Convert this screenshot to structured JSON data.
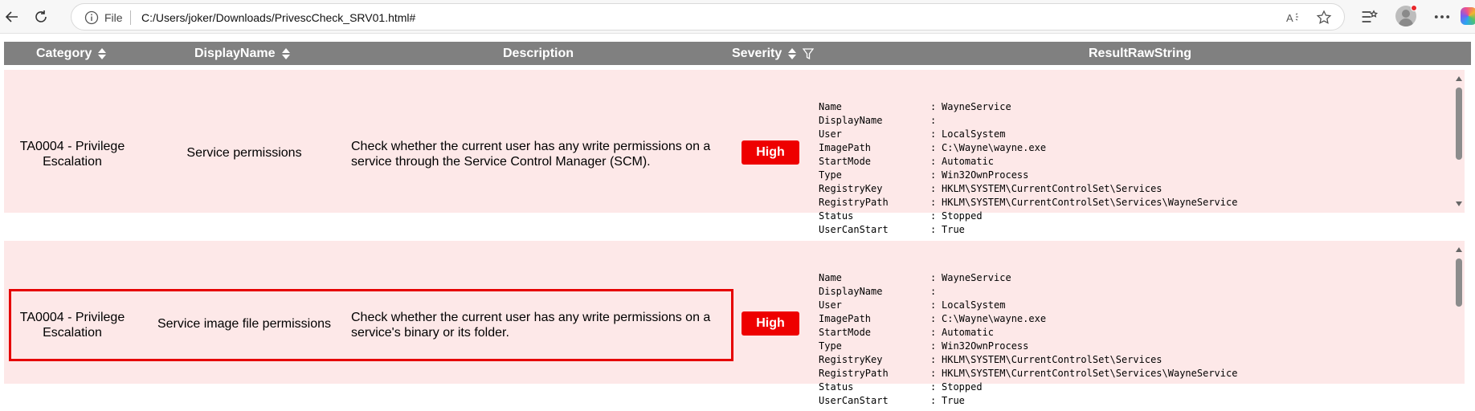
{
  "browser": {
    "file_label": "File",
    "url": "C:/Users/joker/Downloads/PrivescCheck_SRV01.html#",
    "icons": [
      "back-icon",
      "reload-icon",
      "info-icon",
      "read-aloud-icon",
      "favorite-icon",
      "collections-icon",
      "profile-avatar",
      "more-icon",
      "copilot-icon"
    ]
  },
  "table": {
    "headers": {
      "category": "Category",
      "displayname": "DisplayName",
      "description": "Description",
      "severity": "Severity",
      "resultrawstring": "ResultRawString"
    },
    "rows": [
      {
        "category_line1": "TA0004 - Privilege",
        "category_line2": "Escalation",
        "displayname": "Service permissions",
        "description_line1": "Check whether the current user has any write permissions on a",
        "description_line2": "service through the Service Control Manager (SCM).",
        "severity": "High",
        "raw": [
          {
            "key": "Name",
            "value": "WayneService"
          },
          {
            "key": "DisplayName",
            "value": ""
          },
          {
            "key": "User",
            "value": "LocalSystem"
          },
          {
            "key": "ImagePath",
            "value": "C:\\Wayne\\wayne.exe"
          },
          {
            "key": "StartMode",
            "value": "Automatic"
          },
          {
            "key": "Type",
            "value": "Win32OwnProcess"
          },
          {
            "key": "RegistryKey",
            "value": "HKLM\\SYSTEM\\CurrentControlSet\\Services"
          },
          {
            "key": "RegistryPath",
            "value": "HKLM\\SYSTEM\\CurrentControlSet\\Services\\WayneService"
          },
          {
            "key": "Status",
            "value": "Stopped"
          },
          {
            "key": "UserCanStart",
            "value": "True"
          }
        ]
      },
      {
        "category_line1": "TA0004 - Privilege",
        "category_line2": "Escalation",
        "displayname": "Service image file permissions",
        "description_line1": "Check whether the current user has any write permissions on a",
        "description_line2": "service's binary or its folder.",
        "severity": "High",
        "raw": [
          {
            "key": "Name",
            "value": "WayneService"
          },
          {
            "key": "DisplayName",
            "value": ""
          },
          {
            "key": "User",
            "value": "LocalSystem"
          },
          {
            "key": "ImagePath",
            "value": "C:\\Wayne\\wayne.exe"
          },
          {
            "key": "StartMode",
            "value": "Automatic"
          },
          {
            "key": "Type",
            "value": "Win32OwnProcess"
          },
          {
            "key": "RegistryKey",
            "value": "HKLM\\SYSTEM\\CurrentControlSet\\Services"
          },
          {
            "key": "RegistryPath",
            "value": "HKLM\\SYSTEM\\CurrentControlSet\\Services\\WayneService"
          },
          {
            "key": "Status",
            "value": "Stopped"
          },
          {
            "key": "UserCanStart",
            "value": "True"
          }
        ]
      }
    ],
    "raw_separator": ":"
  },
  "colors": {
    "header_bg": "#808080",
    "row_bg": "#fde8e8",
    "severity_high": "#ee0000",
    "highlight_border": "#e60000"
  }
}
